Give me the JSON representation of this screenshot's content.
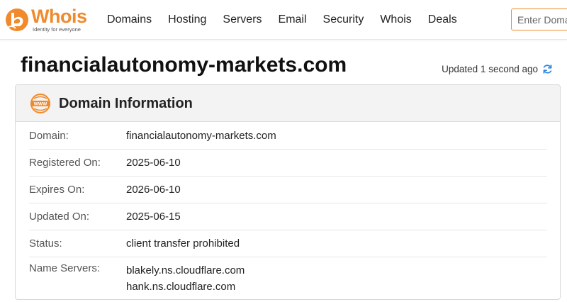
{
  "brand": {
    "name": "Whois",
    "tagline": "Identity for everyone",
    "accent_color": "#f08a2c"
  },
  "nav": {
    "items": [
      "Domains",
      "Hosting",
      "Servers",
      "Email",
      "Security",
      "Whois",
      "Deals"
    ]
  },
  "search": {
    "placeholder": "Enter Domain"
  },
  "page": {
    "title": "financialautonomy-markets.com",
    "updated": "Updated 1 second ago",
    "refresh_icon": "refresh-icon"
  },
  "card": {
    "icon": "www-icon",
    "title": "Domain Information",
    "rows": [
      {
        "label": "Domain:",
        "value": "financialautonomy-markets.com"
      },
      {
        "label": "Registered On:",
        "value": "2025-06-10"
      },
      {
        "label": "Expires On:",
        "value": "2026-06-10"
      },
      {
        "label": "Updated On:",
        "value": "2025-06-15"
      },
      {
        "label": "Status:",
        "value": "client transfer prohibited"
      }
    ],
    "name_servers": {
      "label": "Name Servers:",
      "values": [
        "blakely.ns.cloudflare.com",
        "hank.ns.cloudflare.com"
      ]
    }
  }
}
